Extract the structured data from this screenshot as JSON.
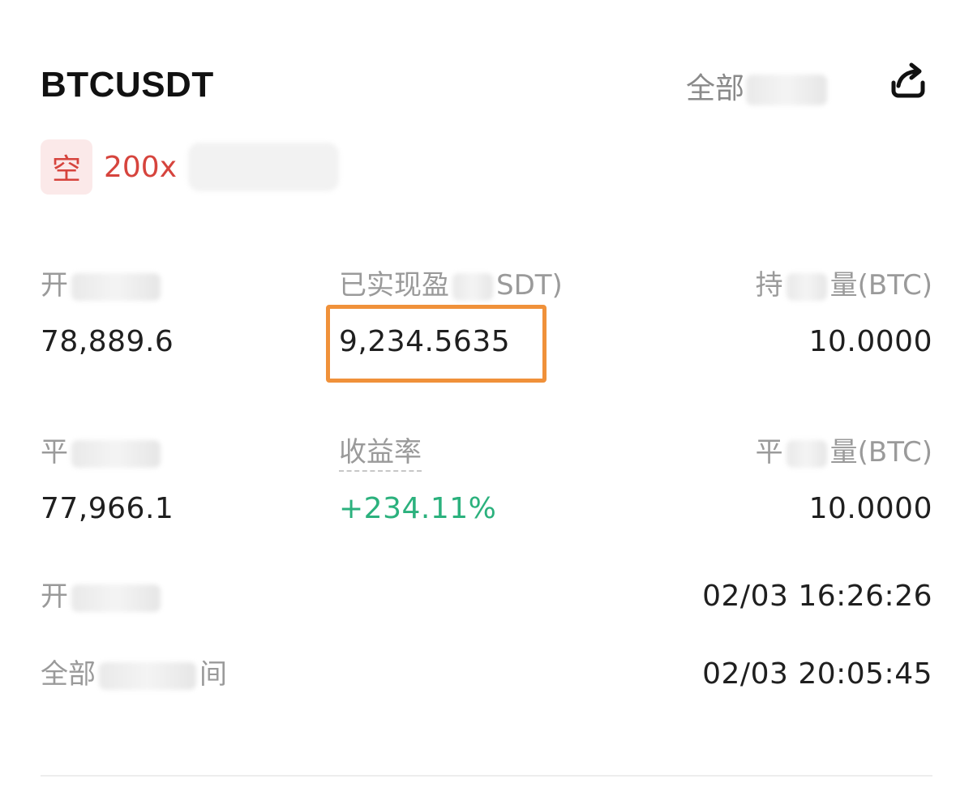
{
  "header": {
    "symbol": "BTCUSDT",
    "status_label": "全部"
  },
  "tags": {
    "side": "空",
    "leverage": "200x"
  },
  "metrics": {
    "open_price": {
      "label": "开",
      "value": "78,889.6"
    },
    "realized_pnl": {
      "label": "已实现盈",
      "unit": "SDT)",
      "value": "9,234.5635"
    },
    "position_size": {
      "label": "持",
      "unit": "量(BTC)",
      "value": "10.0000"
    },
    "close_price": {
      "label": "平",
      "value": "77,966.1"
    },
    "roi": {
      "label": "收益率",
      "value": "+234.11%"
    },
    "close_size": {
      "label": "平",
      "unit": "量(BTC)",
      "value": "10.0000"
    }
  },
  "times": {
    "open_time": {
      "label": "开",
      "value": "02/03 16:26:26"
    },
    "close_time": {
      "label": "全部",
      "label_end": "间",
      "value": "02/03 20:05:45"
    }
  },
  "colors": {
    "short_red": "#d6443d",
    "profit_green": "#2bb17d",
    "highlight_orange": "#f0913a"
  },
  "icons": {
    "share": "share-icon"
  }
}
